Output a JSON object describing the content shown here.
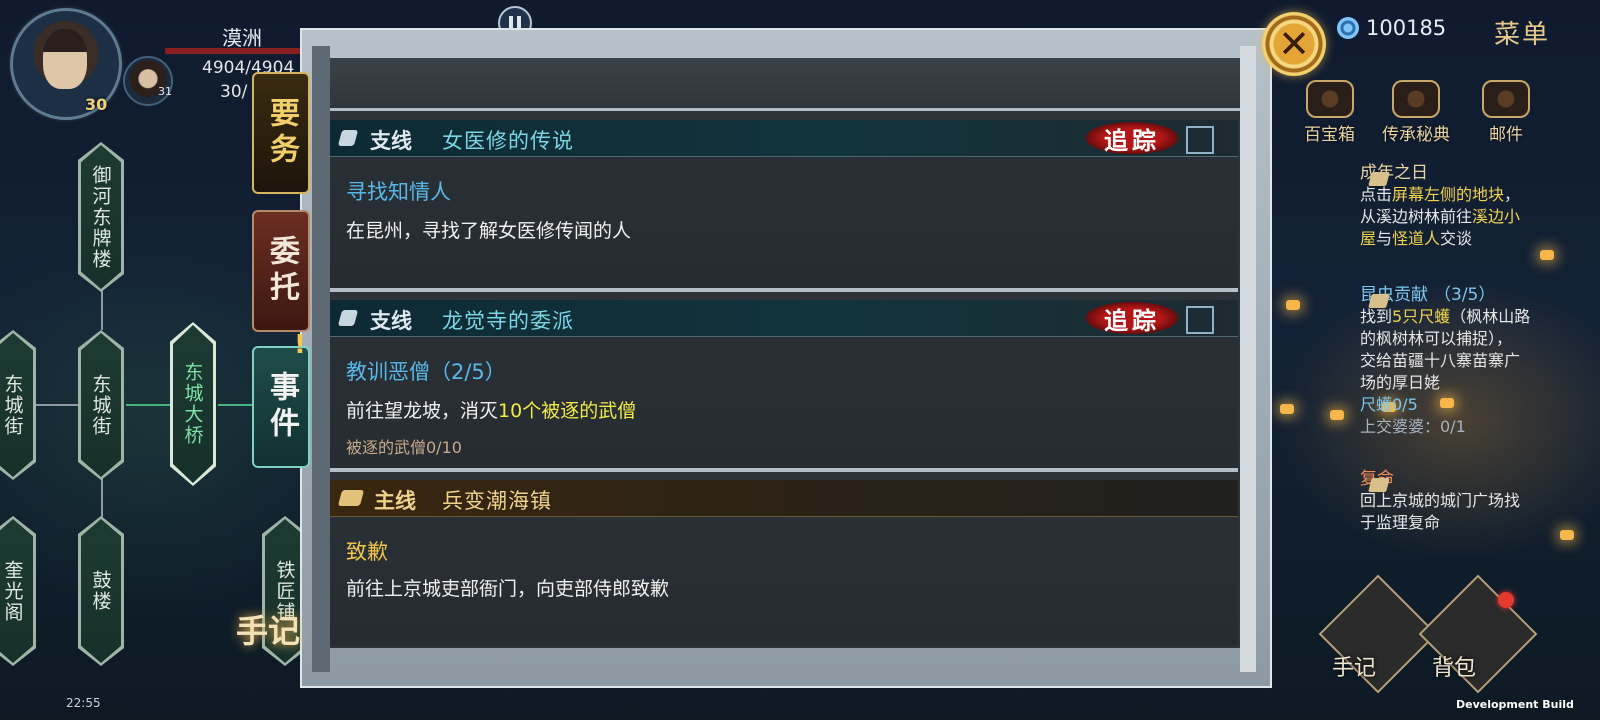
{
  "hud": {
    "hero_name": "漠洲",
    "hp": "4904/4904",
    "mp": "30/",
    "level_main": "30",
    "level_companion": "31",
    "currency": "100185",
    "menu_label": "菜单",
    "time": "22:55",
    "dev_build": "Development Build",
    "top_icons": [
      {
        "label": "百宝箱"
      },
      {
        "label": "传承秘典"
      },
      {
        "label": "邮件"
      }
    ]
  },
  "map": {
    "nodes": [
      {
        "label": "御河东牌楼"
      },
      {
        "label": "东城街"
      },
      {
        "label": "东城街"
      },
      {
        "label": "东城大桥"
      },
      {
        "label": "奎光阁"
      },
      {
        "label": "鼓楼"
      },
      {
        "label": "铁匠铺"
      }
    ]
  },
  "tabs": {
    "yaowu": "要务",
    "weituo": "委托",
    "shijian": "事件",
    "alert": "!",
    "journal": "手记"
  },
  "quests": [
    {
      "type": "支线",
      "name": "女医修的传说",
      "track": "追踪",
      "title": "寻找知情人",
      "desc": "在昆州，寻找了解女医修传闻的人"
    },
    {
      "type": "支线",
      "name": "龙觉寺的委派",
      "track": "追踪",
      "title": "教训恶僧（2/5）",
      "desc_prefix": "前往望龙坡，消灭",
      "desc_highlight": "10个被逐的武僧",
      "progress": "被逐的武僧0/10"
    },
    {
      "type": "主线",
      "name": "兵变潮海镇",
      "title": "致歉",
      "desc": "前往上京城吏部衙门，向吏部侍郎致歉"
    }
  ],
  "side_quests": [
    {
      "title": "成年之日",
      "line1_a": "点击",
      "line1_hl": "屏幕左侧的地块",
      "line1_b": "，",
      "line2_a": "从溪边树林前往",
      "line2_hl": "溪边小",
      "line3_hl1": "屋",
      "line3_a": "与",
      "line3_hl2": "怪道人",
      "line3_b": "交谈"
    },
    {
      "title": "昆虫贡献",
      "count": "（3/5）",
      "line1_a": "找到",
      "line1_hl": "5只尺蠖",
      "line1_b": "（枫林山路",
      "line2": "的枫树林可以捕捉），",
      "line3": "交给苗疆十八寨苗寨广",
      "line4": "场的厚日姥",
      "prog1": "尺蠖0/5",
      "prog2": "上交婆婆：0/1"
    },
    {
      "title": "复命",
      "line1": "回上京城的城门广场找",
      "line2": "于监理复命"
    }
  ],
  "bottom_buttons": {
    "journal": "手记",
    "bag": "背包"
  },
  "close_label": "✕"
}
